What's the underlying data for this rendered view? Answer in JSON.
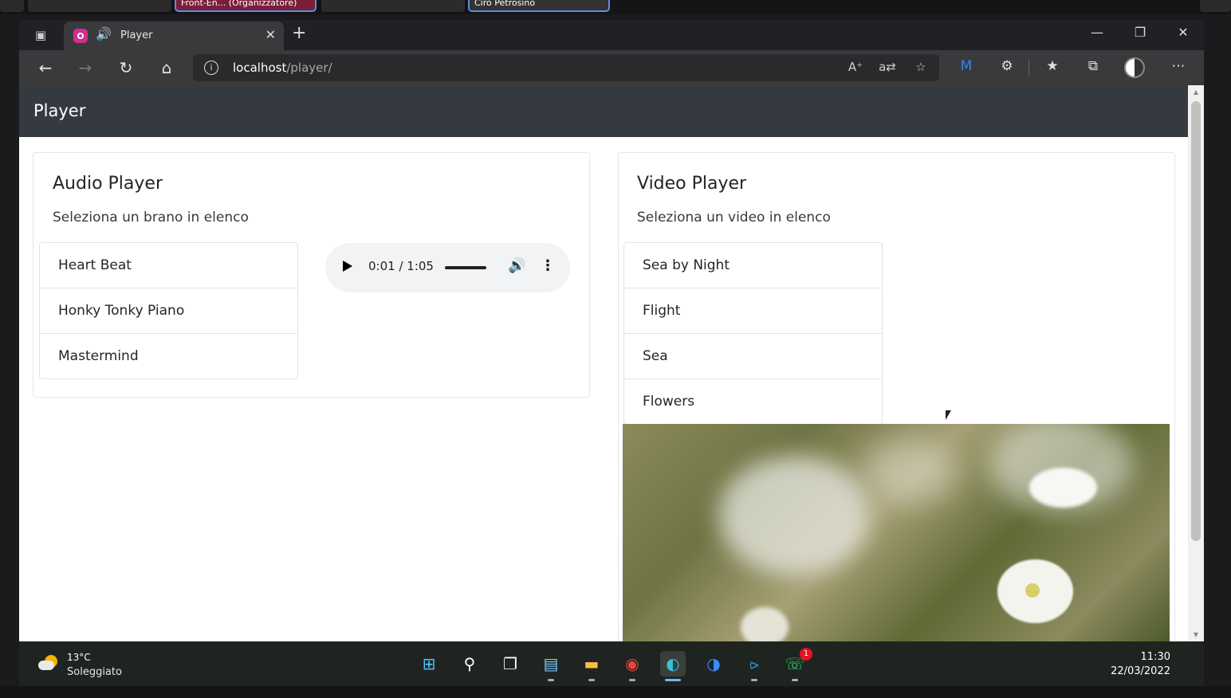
{
  "meeting": {
    "organizer_label": "Front-En... (Organizzatore)",
    "presenter_label": "Ciro Petrosino"
  },
  "browser": {
    "tab_title": "Player",
    "address_host": "localhost",
    "address_path": "/player/"
  },
  "page": {
    "brand": "Player",
    "audio_card": {
      "title": "Audio Player",
      "subtitle": "Seleziona un brano in elenco",
      "tracks": [
        "Heart Beat",
        "Honky Tonky Piano",
        "Mastermind"
      ],
      "player": {
        "time": "0:01 / 1:05",
        "volume_level": 0.95
      }
    },
    "video_card": {
      "title": "Video Player",
      "subtitle": "Seleziona un video in elenco",
      "videos": [
        "Sea by Night",
        "Flight",
        "Sea",
        "Flowers"
      ]
    }
  },
  "taskbar": {
    "weather_temp": "13°C",
    "weather_desc": "Soleggiato",
    "time": "11:30",
    "date": "22/03/2022",
    "whatsapp_badge": "1",
    "icons": [
      "start-icon",
      "search-icon",
      "task-view-icon",
      "notepad-icon",
      "file-explorer-icon",
      "chrome-icon",
      "edge-icon",
      "firefox-icon",
      "vscode-icon",
      "whatsapp-icon"
    ]
  }
}
